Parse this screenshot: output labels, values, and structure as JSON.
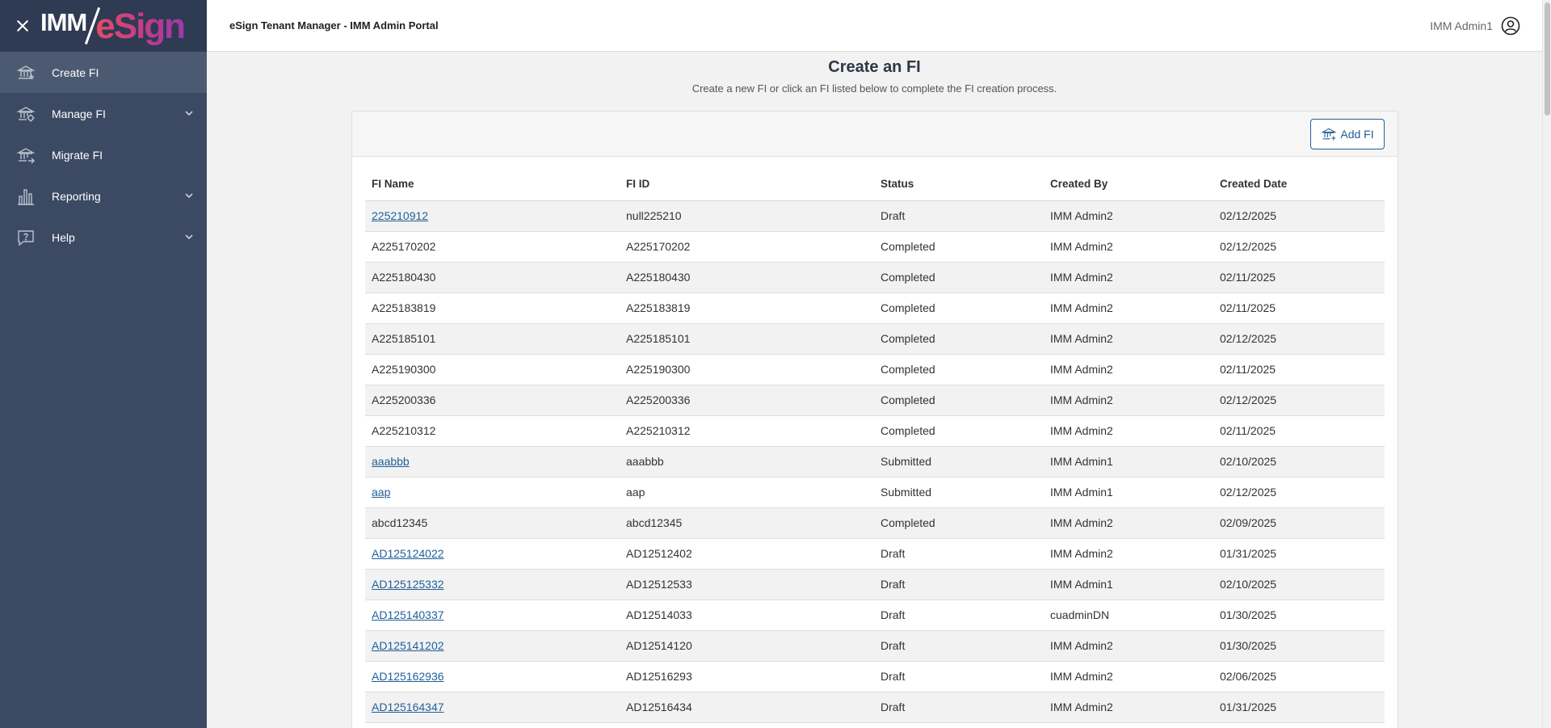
{
  "brand": {
    "logo_left": "IMM",
    "logo_right": "eSign"
  },
  "sidebar": {
    "items": [
      {
        "label": "Create FI",
        "icon": "bank-icon",
        "active": true,
        "expandable": false
      },
      {
        "label": "Manage FI",
        "icon": "bank-gear-icon",
        "active": false,
        "expandable": true
      },
      {
        "label": "Migrate FI",
        "icon": "bank-arrow-icon",
        "active": false,
        "expandable": false
      },
      {
        "label": "Reporting",
        "icon": "bar-chart-icon",
        "active": false,
        "expandable": true
      },
      {
        "label": "Help",
        "icon": "help-icon",
        "active": false,
        "expandable": true
      }
    ]
  },
  "header": {
    "title": "eSign Tenant Manager - IMM Admin Portal",
    "user": "IMM Admin1"
  },
  "main": {
    "title": "Create an FI",
    "subtitle": "Create a new FI or click an FI listed below to complete the FI creation process.",
    "add_button": "Add FI",
    "columns": [
      "FI Name",
      "FI ID",
      "Status",
      "Created By",
      "Created Date"
    ],
    "rows": [
      {
        "name": "225210912",
        "id": "null225210",
        "status": "Draft",
        "by": "IMM Admin2",
        "date": "02/12/2025",
        "link": true
      },
      {
        "name": "A225170202",
        "id": "A225170202",
        "status": "Completed",
        "by": "IMM Admin2",
        "date": "02/12/2025",
        "link": false
      },
      {
        "name": "A225180430",
        "id": "A225180430",
        "status": "Completed",
        "by": "IMM Admin2",
        "date": "02/11/2025",
        "link": false
      },
      {
        "name": "A225183819",
        "id": "A225183819",
        "status": "Completed",
        "by": "IMM Admin2",
        "date": "02/11/2025",
        "link": false
      },
      {
        "name": "A225185101",
        "id": "A225185101",
        "status": "Completed",
        "by": "IMM Admin2",
        "date": "02/12/2025",
        "link": false
      },
      {
        "name": "A225190300",
        "id": "A225190300",
        "status": "Completed",
        "by": "IMM Admin2",
        "date": "02/11/2025",
        "link": false
      },
      {
        "name": "A225200336",
        "id": "A225200336",
        "status": "Completed",
        "by": "IMM Admin2",
        "date": "02/12/2025",
        "link": false
      },
      {
        "name": "A225210312",
        "id": "A225210312",
        "status": "Completed",
        "by": "IMM Admin2",
        "date": "02/11/2025",
        "link": false
      },
      {
        "name": "aaabbb",
        "id": "aaabbb",
        "status": "Submitted",
        "by": "IMM Admin1",
        "date": "02/10/2025",
        "link": true
      },
      {
        "name": "aap",
        "id": "aap",
        "status": "Submitted",
        "by": "IMM Admin1",
        "date": "02/12/2025",
        "link": true
      },
      {
        "name": "abcd12345",
        "id": "abcd12345",
        "status": "Completed",
        "by": "IMM Admin2",
        "date": "02/09/2025",
        "link": false
      },
      {
        "name": "AD125124022",
        "id": "AD12512402",
        "status": "Draft",
        "by": "IMM Admin2",
        "date": "01/31/2025",
        "link": true
      },
      {
        "name": "AD125125332",
        "id": "AD12512533",
        "status": "Draft",
        "by": "IMM Admin1",
        "date": "02/10/2025",
        "link": true
      },
      {
        "name": "AD125140337",
        "id": "AD12514033",
        "status": "Draft",
        "by": "cuadminDN",
        "date": "01/30/2025",
        "link": true
      },
      {
        "name": "AD125141202",
        "id": "AD12514120",
        "status": "Draft",
        "by": "IMM Admin2",
        "date": "01/30/2025",
        "link": true
      },
      {
        "name": "AD125162936",
        "id": "AD12516293",
        "status": "Draft",
        "by": "IMM Admin2",
        "date": "02/06/2025",
        "link": true
      },
      {
        "name": "AD125164347",
        "id": "AD12516434",
        "status": "Draft",
        "by": "IMM Admin2",
        "date": "01/31/2025",
        "link": true
      }
    ]
  }
}
